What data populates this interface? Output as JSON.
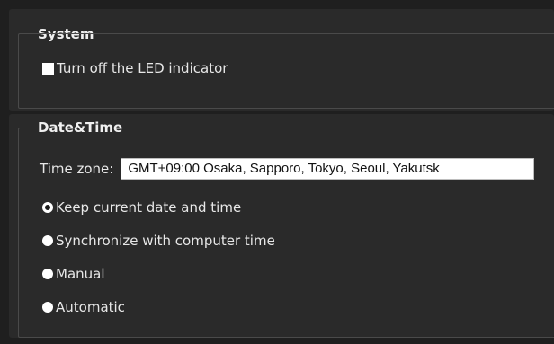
{
  "system": {
    "legend": "System",
    "led_label": "Turn off the LED indicator"
  },
  "datetime": {
    "legend": "Date&Time",
    "timezone_label": "Time zone:",
    "timezone_value": "GMT+09:00 Osaka, Sapporo, Tokyo, Seoul, Yakutsk",
    "options": [
      {
        "label": "Keep current date and time",
        "selected": true
      },
      {
        "label": "Synchronize with computer time",
        "selected": false
      },
      {
        "label": "Manual",
        "selected": false
      },
      {
        "label": "Automatic",
        "selected": false
      }
    ]
  },
  "colors": {
    "background": "#1f1f1f",
    "panel": "#2a2a2a",
    "border": "#4a4a4a",
    "text": "#e8e8e8"
  }
}
